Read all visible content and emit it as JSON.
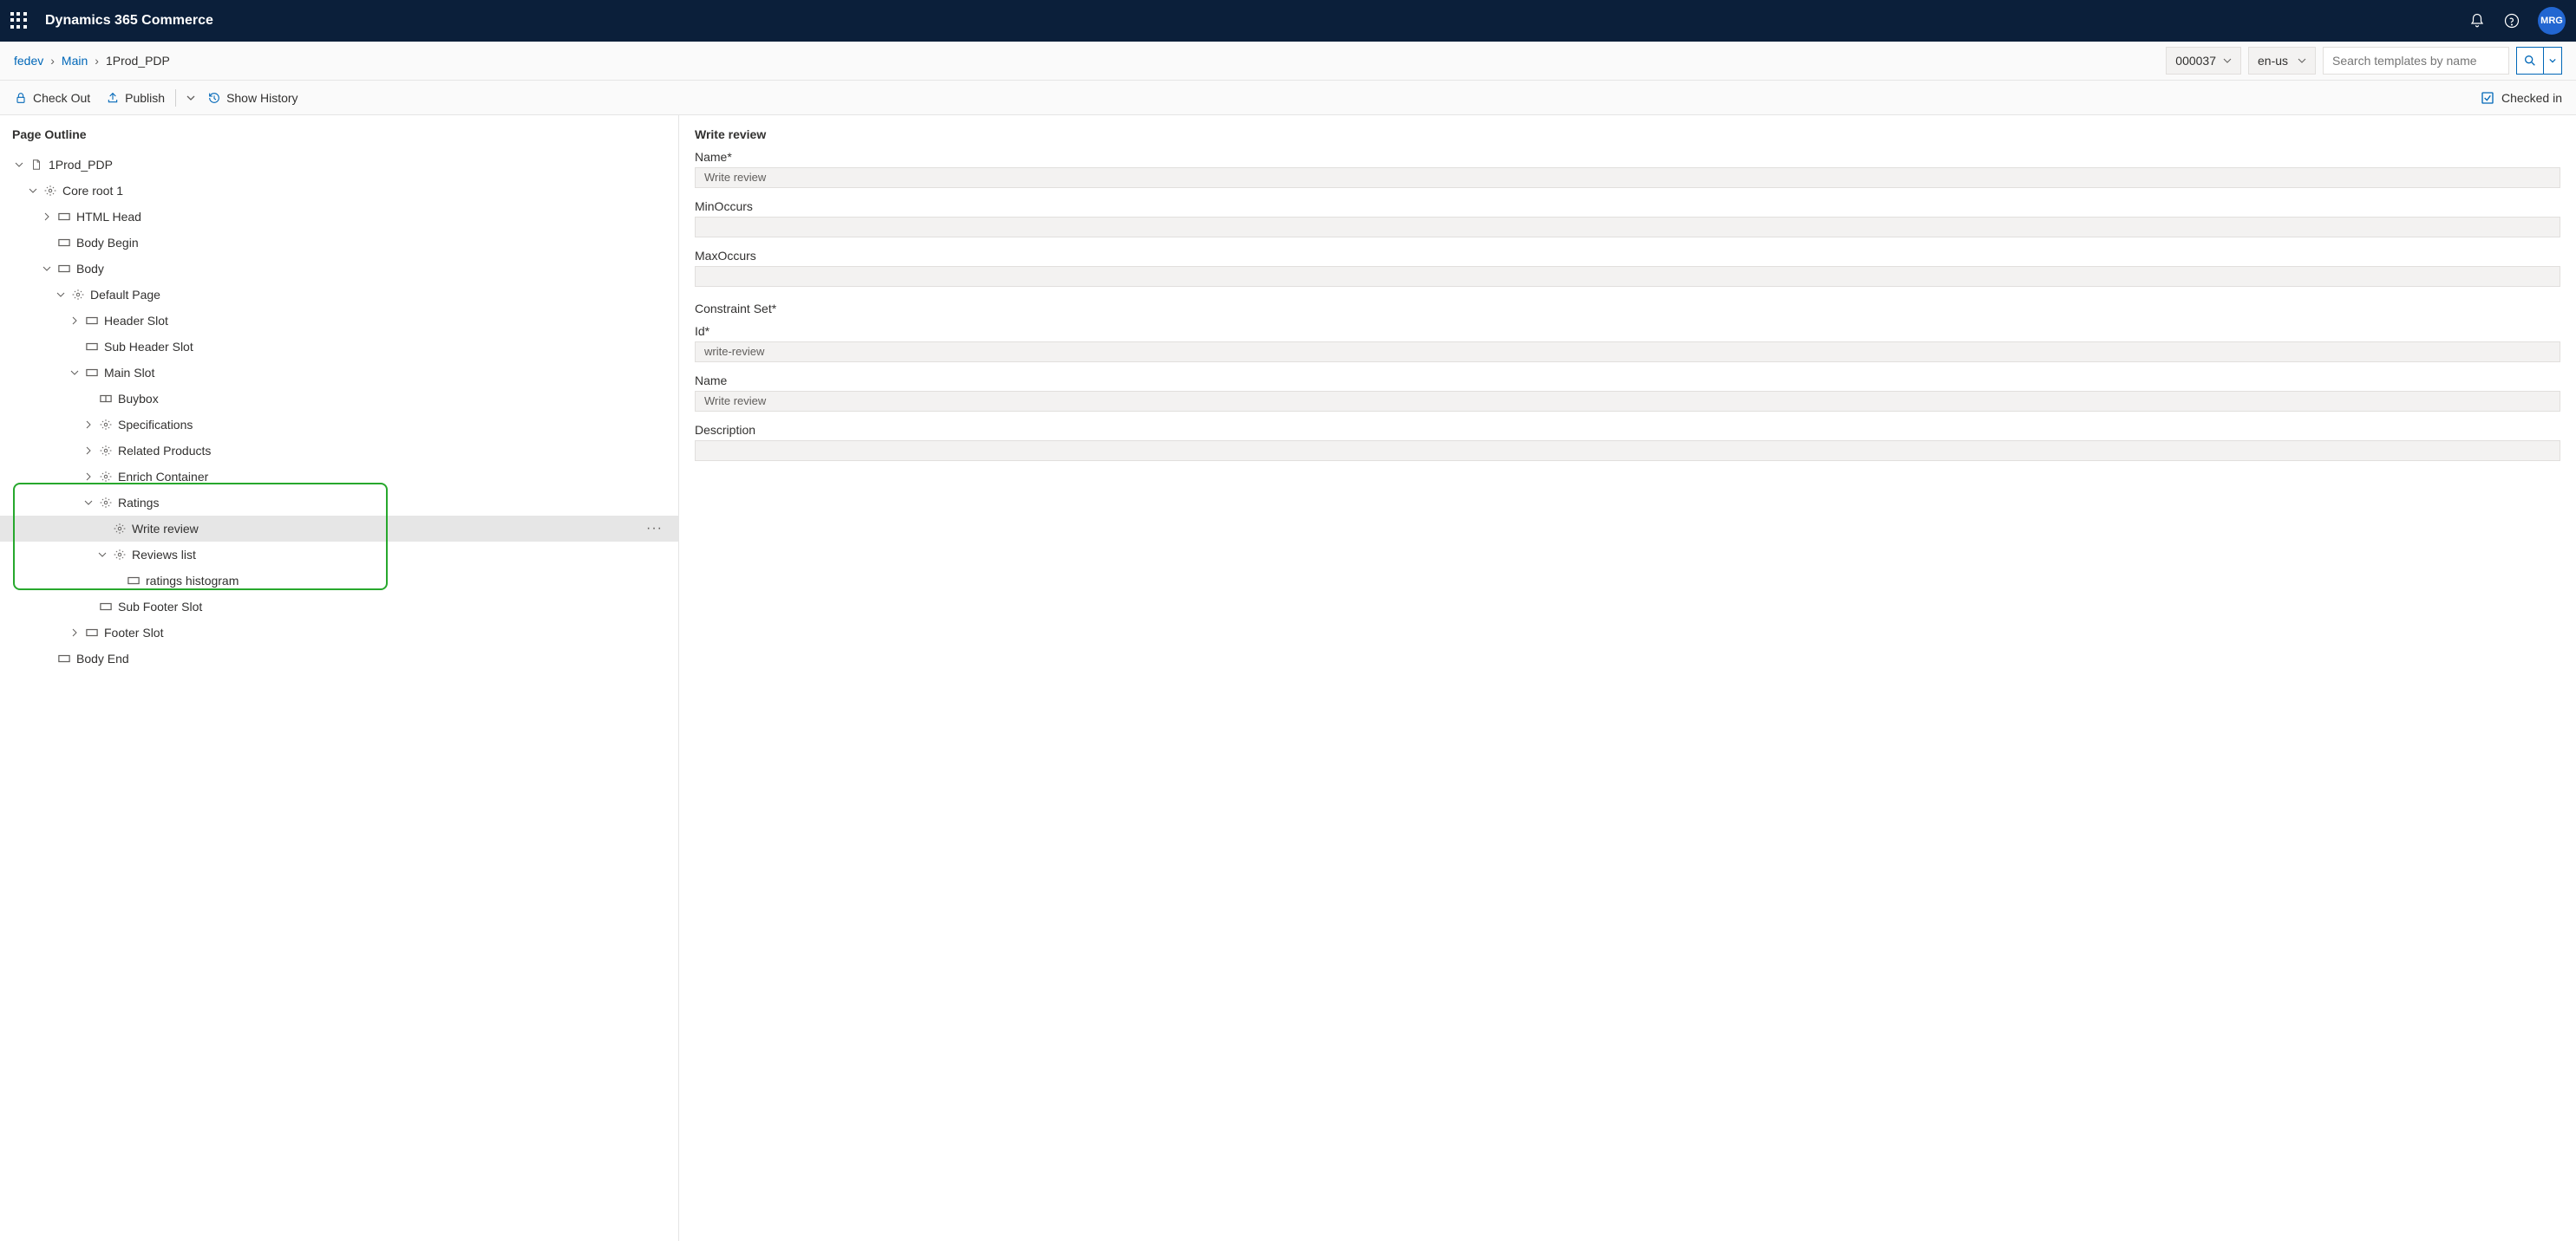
{
  "header": {
    "app_title": "Dynamics 365 Commerce",
    "avatar": "MRG"
  },
  "breadcrumb": {
    "items": [
      "fedev",
      "Main",
      "1Prod_PDP"
    ]
  },
  "filters": {
    "site_id": "000037",
    "locale_list": "en-us",
    "search_placeholder": "Search templates by name"
  },
  "toolbar": {
    "check_out": "Check Out",
    "publish": "Publish",
    "show_history": "Show History",
    "checked_in": "Checked in"
  },
  "outline": {
    "title": "Page Outline",
    "nodes": {
      "root": "1Prod_PDP",
      "core_root": "Core root 1",
      "html_head": "HTML Head",
      "body_begin": "Body Begin",
      "body": "Body",
      "default_page": "Default Page",
      "header_slot": "Header Slot",
      "sub_header_slot": "Sub Header Slot",
      "main_slot": "Main Slot",
      "buybox": "Buybox",
      "specifications": "Specifications",
      "related_products": "Related Products",
      "enrich_container": "Enrich Container",
      "ratings": "Ratings",
      "write_review": "Write review",
      "reviews_list": "Reviews list",
      "ratings_histogram": "ratings histogram",
      "sub_footer_slot": "Sub Footer Slot",
      "footer_slot": "Footer Slot",
      "body_end": "Body End"
    }
  },
  "panel": {
    "title": "Write review",
    "name_label": "Name*",
    "name_value": "Write review",
    "min_label": "MinOccurs",
    "min_value": "",
    "max_label": "MaxOccurs",
    "max_value": "",
    "constraint_set": "Constraint Set*",
    "id_label": "Id*",
    "id_value": "write-review",
    "name2_label": "Name",
    "name2_value": "Write review",
    "desc_label": "Description",
    "desc_value": ""
  }
}
